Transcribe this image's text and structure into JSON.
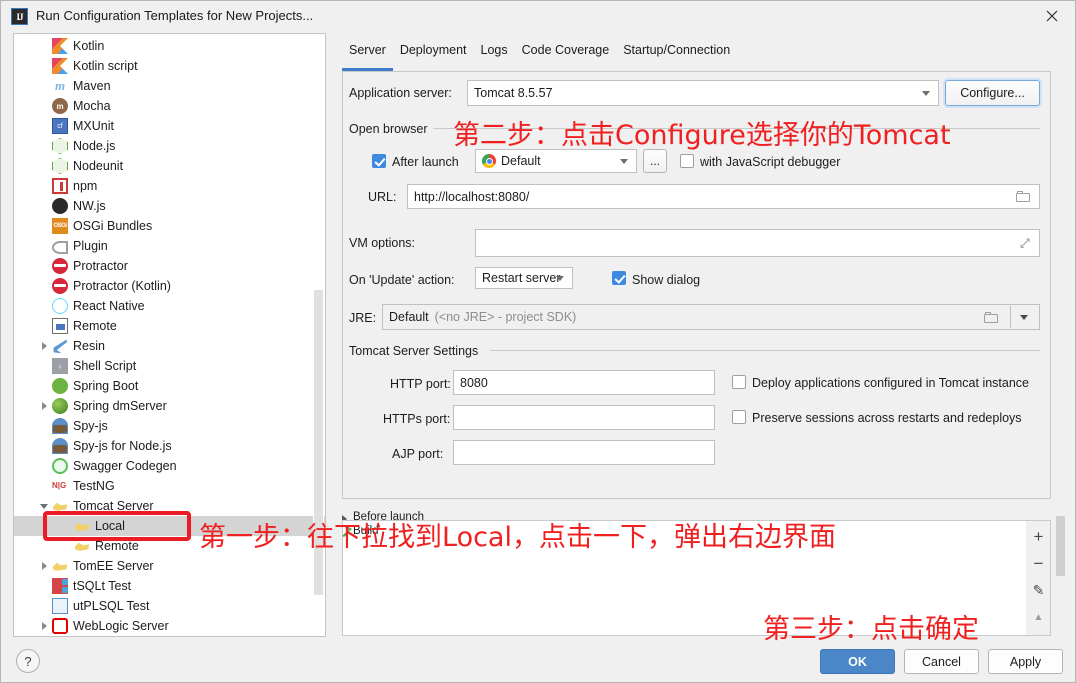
{
  "window": {
    "title": "Run Configuration Templates for New Projects...",
    "app_icon": "intellij-idea-icon",
    "close_icon": "close-icon"
  },
  "tree": {
    "items": [
      {
        "label": "Kotlin",
        "icon": "kotlin-icon",
        "indent": 1,
        "twisty": "none"
      },
      {
        "label": "Kotlin script",
        "icon": "kotlin-icon",
        "indent": 1,
        "twisty": "none"
      },
      {
        "label": "Maven",
        "icon": "maven-icon",
        "indent": 1,
        "twisty": "none"
      },
      {
        "label": "Mocha",
        "icon": "mocha-icon",
        "indent": 1,
        "twisty": "none"
      },
      {
        "label": "MXUnit",
        "icon": "mxunit-icon",
        "indent": 1,
        "twisty": "none"
      },
      {
        "label": "Node.js",
        "icon": "nodejs-icon",
        "indent": 1,
        "twisty": "none"
      },
      {
        "label": "Nodeunit",
        "icon": "nodeunit-icon",
        "indent": 1,
        "twisty": "none"
      },
      {
        "label": "npm",
        "icon": "npm-icon",
        "indent": 1,
        "twisty": "none"
      },
      {
        "label": "NW.js",
        "icon": "nwjs-icon",
        "indent": 1,
        "twisty": "none"
      },
      {
        "label": "OSGi Bundles",
        "icon": "osgi-icon",
        "indent": 1,
        "twisty": "none"
      },
      {
        "label": "Plugin",
        "icon": "plugin-icon",
        "indent": 1,
        "twisty": "none"
      },
      {
        "label": "Protractor",
        "icon": "protractor-icon",
        "indent": 1,
        "twisty": "none"
      },
      {
        "label": "Protractor (Kotlin)",
        "icon": "protractor-icon",
        "indent": 1,
        "twisty": "none"
      },
      {
        "label": "React Native",
        "icon": "react-native-icon",
        "indent": 1,
        "twisty": "none"
      },
      {
        "label": "Remote",
        "icon": "remote-icon",
        "indent": 1,
        "twisty": "none"
      },
      {
        "label": "Resin",
        "icon": "resin-icon",
        "indent": 1,
        "twisty": "right"
      },
      {
        "label": "Shell Script",
        "icon": "shell-script-icon",
        "indent": 1,
        "twisty": "none"
      },
      {
        "label": "Spring Boot",
        "icon": "spring-boot-icon",
        "indent": 1,
        "twisty": "none"
      },
      {
        "label": "Spring dmServer",
        "icon": "spring-dm-icon",
        "indent": 1,
        "twisty": "right"
      },
      {
        "label": "Spy-js",
        "icon": "spy-js-icon",
        "indent": 1,
        "twisty": "none"
      },
      {
        "label": "Spy-js for Node.js",
        "icon": "spy-js-node-icon",
        "indent": 1,
        "twisty": "none"
      },
      {
        "label": "Swagger Codegen",
        "icon": "swagger-icon",
        "indent": 1,
        "twisty": "none"
      },
      {
        "label": "TestNG",
        "icon": "testng-icon",
        "indent": 1,
        "twisty": "none"
      },
      {
        "label": "Tomcat Server",
        "icon": "tomcat-icon",
        "indent": 1,
        "twisty": "down"
      },
      {
        "label": "Local",
        "icon": "tomcat-icon",
        "indent": 2,
        "twisty": "none",
        "selected": true
      },
      {
        "label": "Remote",
        "icon": "tomcat-icon",
        "indent": 2,
        "twisty": "none"
      },
      {
        "label": "TomEE Server",
        "icon": "tomcat-icon",
        "indent": 1,
        "twisty": "right"
      },
      {
        "label": "tSQLt Test",
        "icon": "tsqlt-icon",
        "indent": 1,
        "twisty": "none"
      },
      {
        "label": "utPLSQL Test",
        "icon": "utplsql-icon",
        "indent": 1,
        "twisty": "none"
      },
      {
        "label": "WebLogic Server",
        "icon": "weblogic-icon",
        "indent": 1,
        "twisty": "right"
      }
    ]
  },
  "tabs": [
    {
      "label": "Server",
      "active": true
    },
    {
      "label": "Deployment",
      "active": false
    },
    {
      "label": "Logs",
      "active": false
    },
    {
      "label": "Code Coverage",
      "active": false
    },
    {
      "label": "Startup/Connection",
      "active": false
    }
  ],
  "server_tab": {
    "application_server_label": "Application server:",
    "application_server_value": "Tomcat 8.5.57",
    "configure_button": "Configure...",
    "open_browser_label": "Open browser",
    "after_launch_label": "After launch",
    "after_launch_checked": true,
    "browser_value": "Default",
    "browser_icon": "chrome-icon",
    "browse_button": "...",
    "js_debugger_label": "with JavaScript debugger",
    "js_debugger_checked": false,
    "url_label": "URL:",
    "url_value": "http://localhost:8080/",
    "vm_options_label": "VM options:",
    "vm_options_value": "",
    "on_update_label": "On 'Update' action:",
    "on_update_value": "Restart server",
    "show_dialog_label": "Show dialog",
    "show_dialog_checked": true,
    "jre_label": "JRE:",
    "jre_value": "Default",
    "jre_hint": "(<no JRE>  -  project SDK)",
    "tomcat_settings_label": "Tomcat Server Settings",
    "http_port_label": "HTTP port:",
    "http_port_value": "8080",
    "https_port_label": "HTTPs port:",
    "https_port_value": "",
    "ajp_port_label": "AJP port:",
    "ajp_port_value": "",
    "deploy_apps_label": "Deploy applications configured in Tomcat instance",
    "deploy_apps_checked": false,
    "preserve_sessions_label": "Preserve sessions across restarts and redeploys",
    "preserve_sessions_checked": false
  },
  "before_launch": {
    "header": "Before launch",
    "items": [
      {
        "label": "Build",
        "icon": "hammer-icon"
      }
    ],
    "toolbar": [
      {
        "icon": "plus-icon",
        "glyph": "+"
      },
      {
        "icon": "minus-icon",
        "glyph": "−"
      },
      {
        "icon": "pencil-icon",
        "glyph": "✎"
      },
      {
        "icon": "arrow-up-icon",
        "glyph": "▲"
      }
    ]
  },
  "footer": {
    "help_label": "?",
    "ok_label": "OK",
    "cancel_label": "Cancel",
    "apply_label": "Apply"
  },
  "annotations": {
    "step1": "第一步：往下拉找到Local，点击一下，弹出右边界面",
    "step2": "第二步：点击Configure选择你的Tomcat",
    "step3": "第三步：点击确定",
    "color": "#f02020"
  }
}
